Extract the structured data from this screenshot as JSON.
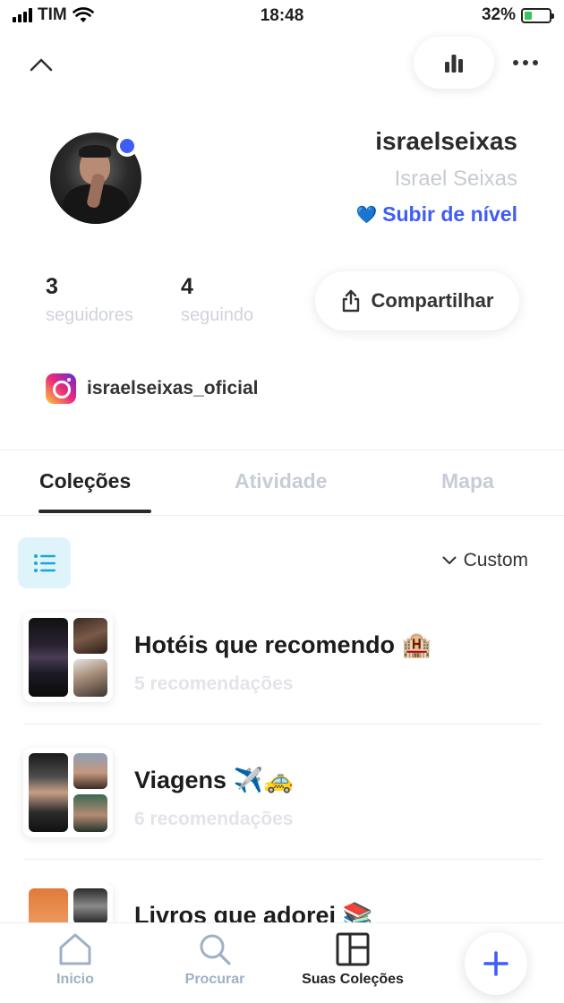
{
  "status_bar": {
    "carrier": "TIM",
    "time": "18:48",
    "battery": "32%",
    "battery_level": 0.32
  },
  "nav": {
    "collapse_icon": "chevron-up-icon",
    "stats_icon": "bar-chart-icon",
    "more_icon": "more-horizontal-icon"
  },
  "profile": {
    "username": "israelseixas",
    "full_name": "Israel Seixas",
    "level_up_emoji": "💙",
    "level_up_label": "Subir de nível",
    "followers_count": "3",
    "followers_label": "seguidores",
    "following_count": "4",
    "following_label": "seguindo",
    "share_label": "Compartilhar",
    "instagram_handle": "israelseixas_oficial",
    "accent_color": "#3f5df5"
  },
  "tabs": [
    {
      "label": "Coleções",
      "active": true
    },
    {
      "label": "Atividade",
      "active": false
    },
    {
      "label": "Mapa",
      "active": false
    }
  ],
  "list_controls": {
    "view_icon": "list-icon",
    "sort_label": "Custom"
  },
  "collections": [
    {
      "title": "Hotéis que recomendo 🏨",
      "count": "5 recomendações"
    },
    {
      "title": "Viagens ✈️🚕",
      "count": "6 recomendações"
    },
    {
      "title": "Livros que adorei 📚",
      "count": ""
    }
  ],
  "tabbar": {
    "items": [
      {
        "label": "Inicio",
        "icon": "home-icon",
        "active": false
      },
      {
        "label": "Procurar",
        "icon": "search-icon",
        "active": false
      },
      {
        "label": "Suas Coleções",
        "icon": "layout-icon",
        "active": true
      }
    ],
    "add_icon": "plus-icon"
  }
}
